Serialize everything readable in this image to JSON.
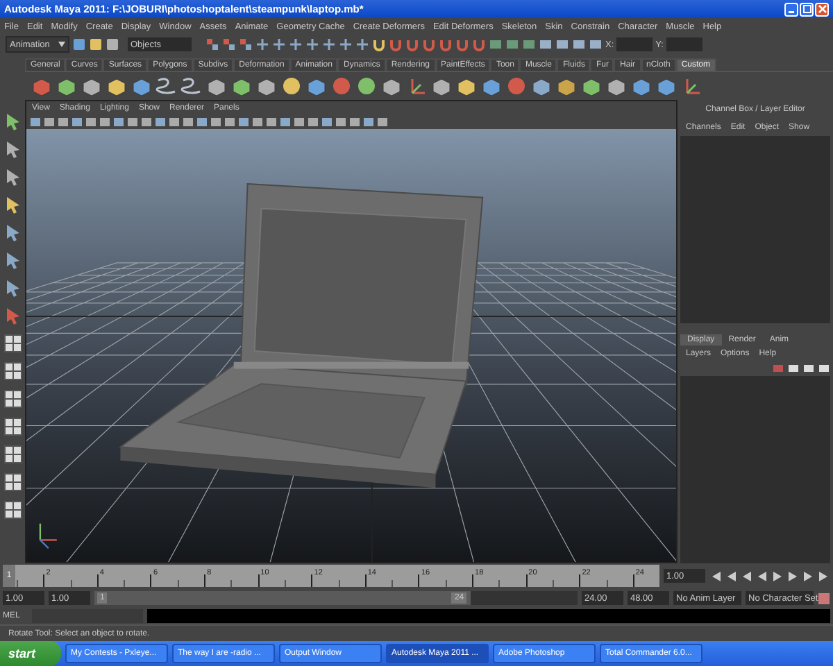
{
  "window": {
    "title": "Autodesk Maya 2011: F:\\JOBURI\\photoshoptalent\\steampunk\\laptop.mb*"
  },
  "menu_bar": [
    "File",
    "Edit",
    "Modify",
    "Create",
    "Display",
    "Window",
    "Assets",
    "Animate",
    "Geometry Cache",
    "Create Deformers",
    "Edit Deformers",
    "Skeleton",
    "Skin",
    "Constrain",
    "Character",
    "Muscle",
    "Help"
  ],
  "status_line": {
    "mode": "Animation",
    "selection_field": "Objects",
    "x_label": "X:",
    "y_label": "Y:"
  },
  "shelf": {
    "tabs": [
      {
        "label": "General",
        "selected": false
      },
      {
        "label": "Curves",
        "selected": false
      },
      {
        "label": "Surfaces",
        "selected": false
      },
      {
        "label": "Polygons",
        "selected": false
      },
      {
        "label": "Subdivs",
        "selected": false
      },
      {
        "label": "Deformation",
        "selected": false
      },
      {
        "label": "Animation",
        "selected": false
      },
      {
        "label": "Dynamics",
        "selected": false
      },
      {
        "label": "Rendering",
        "selected": false
      },
      {
        "label": "PaintEffects",
        "selected": false
      },
      {
        "label": "Toon",
        "selected": false
      },
      {
        "label": "Muscle",
        "selected": false
      },
      {
        "label": "Fluids",
        "selected": false
      },
      {
        "label": "Fur",
        "selected": false
      },
      {
        "label": "Hair",
        "selected": false
      },
      {
        "label": "nCloth",
        "selected": false
      },
      {
        "label": "Custom",
        "selected": true
      }
    ]
  },
  "viewport": {
    "menu": [
      "View",
      "Shading",
      "Lighting",
      "Show",
      "Renderer",
      "Panels"
    ]
  },
  "channel_box": {
    "title": "Channel Box / Layer Editor",
    "menu": [
      "Channels",
      "Edit",
      "Object",
      "Show"
    ]
  },
  "layer_editor": {
    "tabs": [
      {
        "label": "Display",
        "selected": true
      },
      {
        "label": "Render",
        "selected": false
      },
      {
        "label": "Anim",
        "selected": false
      }
    ],
    "menu": [
      "Layers",
      "Options",
      "Help"
    ]
  },
  "time_slider": {
    "current_frame": "1",
    "tick_labels": [
      "2",
      "4",
      "6",
      "8",
      "10",
      "12",
      "14",
      "16",
      "18",
      "20",
      "22",
      "24"
    ],
    "current_time": "1.00"
  },
  "range_slider": {
    "level": 0.78,
    "start_time": "1.00",
    "playback_start": "1.00",
    "range_start": "1",
    "range_end": "24",
    "playback_end": "24.00",
    "end_time": "48.00",
    "anim_layer": "No Anim Layer",
    "character_set": "No Character Set"
  },
  "command_line": {
    "label": "MEL"
  },
  "help_line": "Rotate Tool: Select an object to rotate.",
  "taskbar": {
    "start": "start",
    "items": [
      {
        "label": "My Contests - Pxleye...",
        "selected": false
      },
      {
        "label": "The way I are -radio ...",
        "selected": false
      },
      {
        "label": "Output Window",
        "selected": false
      },
      {
        "label": "Autodesk Maya 2011 ...",
        "selected": true
      },
      {
        "label": "Adobe Photoshop",
        "selected": false
      },
      {
        "label": "Total Commander 6.0...",
        "selected": false
      }
    ]
  }
}
